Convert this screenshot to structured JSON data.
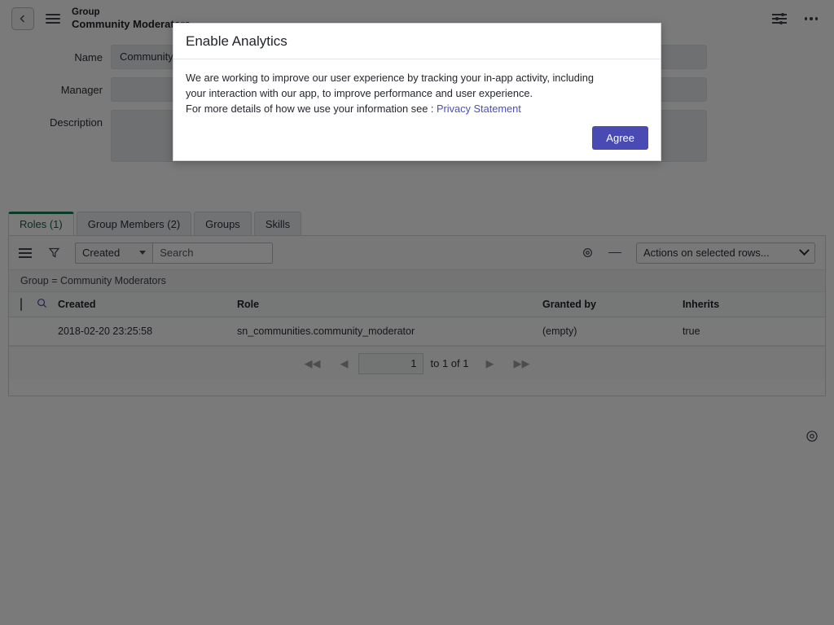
{
  "topbar": {
    "back_icon": "chevron-left-icon",
    "menu_icon": "hamburger-menu-icon",
    "kicker": "Group",
    "title": "Community Moderators",
    "sliders_icon": "sliders-icon",
    "more_icon": "more-horizontal-icon"
  },
  "form": {
    "fields": [
      {
        "label": "Name",
        "value": "Community Moderators"
      },
      {
        "label": "Manager",
        "value": ""
      },
      {
        "label": "Description",
        "value": ""
      }
    ]
  },
  "tabs": [
    {
      "label": "Roles (1)",
      "active": true
    },
    {
      "label": "Group Members (2)",
      "active": false
    },
    {
      "label": "Groups",
      "active": false
    },
    {
      "label": "Skills",
      "active": false
    }
  ],
  "list_toolbar": {
    "menu_icon": "list-menu-icon",
    "filter_icon": "funnel-filter-icon",
    "field_select": "Created",
    "search_placeholder": "Search",
    "gear_icon": "gear-icon",
    "collapse_icon": "minus-icon",
    "actions_select": "Actions on selected rows..."
  },
  "breadcrumb": "Group = Community Moderators",
  "table": {
    "select_all_icon": "checkbox-icon",
    "search_icon": "search-icon",
    "columns": [
      "Created",
      "Role",
      "Granted by",
      "Inherits"
    ],
    "rows": [
      {
        "created": "2018-02-20 23:25:58",
        "role": "sn_communities.community_moderator",
        "granted_by": "(empty)",
        "inherits": "true"
      }
    ]
  },
  "pager": {
    "first_icon": "skip-first-icon",
    "prev_icon": "chevron-left-icon",
    "page_value": "1",
    "range_text": "to 1 of 1",
    "next_icon": "chevron-right-icon",
    "last_icon": "skip-last-icon"
  },
  "help_icon": "help-circle-icon",
  "modal": {
    "title": "Enable Analytics",
    "body_line1": "We are working to improve our user experience by tracking your in-app activity, including",
    "body_line2": "your interaction with our app, to improve performance and user experience.",
    "body_line3": "For more details of how we use your information see :",
    "privacy_link": "Privacy Statement",
    "agree_label": "Agree",
    "accent_color": "#4a4ab5"
  }
}
